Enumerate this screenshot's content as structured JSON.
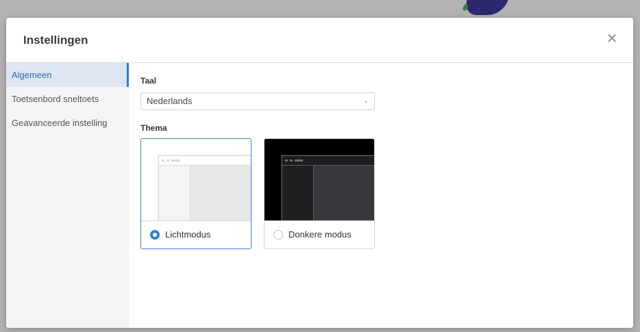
{
  "dialog": {
    "title": "Instellingen",
    "close_symbol": "✕"
  },
  "sidebar": {
    "items": [
      {
        "label": "Algemeen",
        "active": true
      },
      {
        "label": "Toetsenbord sneltoets",
        "active": false
      },
      {
        "label": "Geavanceerde instelling",
        "active": false
      }
    ]
  },
  "general": {
    "language_label": "Taal",
    "language_value": "Nederlands",
    "theme_label": "Thema",
    "themes": [
      {
        "label": "Lichtmodus",
        "selected": true
      },
      {
        "label": "Donkere modus",
        "selected": false
      }
    ]
  },
  "colors": {
    "accent": "#2f7fd8",
    "dark_preview": "#000000"
  }
}
